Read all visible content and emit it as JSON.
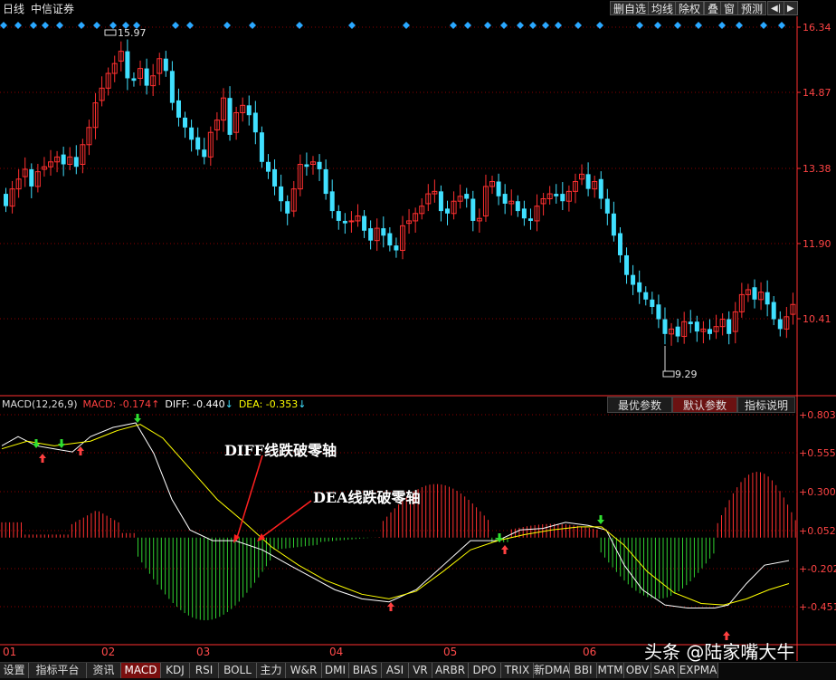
{
  "topbar": {
    "period": "日线",
    "stock_name": "中信证券",
    "buttons": [
      "删自选",
      "均线",
      "除权",
      "叠",
      "窗",
      "预测"
    ],
    "icons": [
      "prev-icon",
      "next-icon"
    ]
  },
  "price_chart": {
    "axis_labels": [
      "16.34",
      "14.87",
      "13.38",
      "11.90",
      "10.41"
    ],
    "high_marker": "15.97",
    "low_marker": "9.29",
    "colors": {
      "up": "#ff3030",
      "down": "#40e0ff",
      "axis": "#ff3030",
      "grid": "#8b0000",
      "diamond": "#2aa8ff"
    }
  },
  "macd_header": {
    "name": "MACD(12,26,9)",
    "macd_label": "MACD: -0.174",
    "macd_arrow": "↑",
    "diff_label": "DIFF: -0.440",
    "diff_arrow": "↓",
    "dea_label": "DEA: -0.353",
    "dea_arrow": "↓",
    "colors": {
      "macd": "#ff3030",
      "diff": "#ffffff",
      "dea": "#ffff00"
    }
  },
  "macd_tabs": [
    "最优参数",
    "默认参数",
    "指标说明"
  ],
  "macd_active_tab": "默认参数",
  "macd_chart": {
    "axis_labels": [
      "0.803",
      "0.555",
      "0.300",
      "0.052",
      "-0.202",
      "-0.451"
    ],
    "annotations": [
      "DIFF线跌破零轴",
      "DEA线跌破零轴"
    ]
  },
  "dates": [
    "01",
    "02",
    "03",
    "04",
    "05",
    "06"
  ],
  "indicator_tabs": [
    "设置",
    "指标平台",
    "资讯",
    "MACD",
    "KDJ",
    "RSI",
    "BOLL",
    "主力",
    "W&R",
    "DMI",
    "BIAS",
    "ASI",
    "VR",
    "ARBR",
    "DPO",
    "TRIX",
    "新DMA",
    "BBI",
    "MTM",
    "OBV",
    "SAR",
    "EXPMA"
  ],
  "active_indicator": "MACD",
  "watermark": "头条 @陆家嘴大牛"
}
